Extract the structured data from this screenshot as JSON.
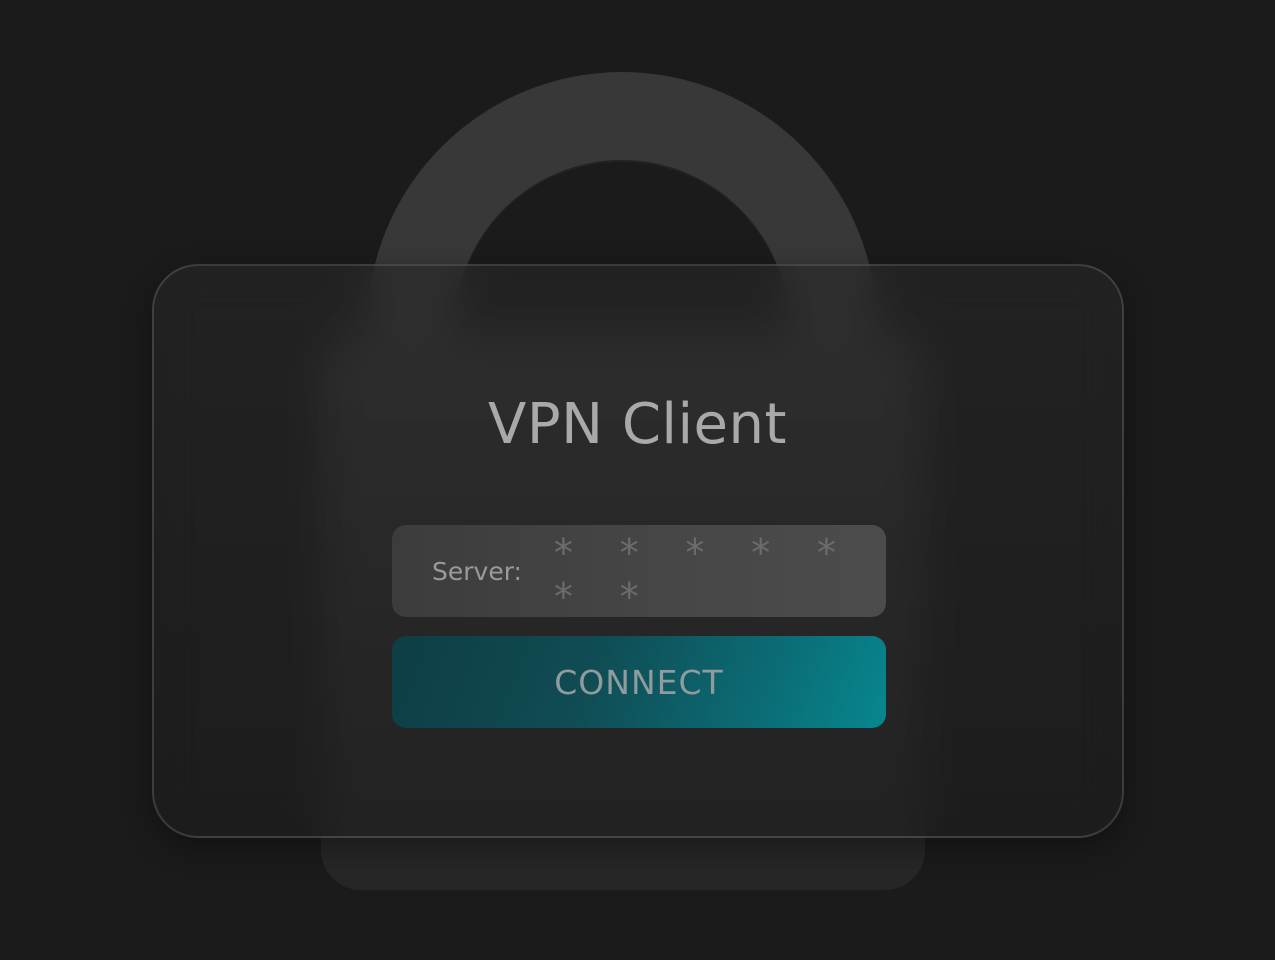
{
  "app": {
    "title": "VPN Client"
  },
  "server": {
    "label": "Server:",
    "value": "* * * * * * *"
  },
  "connect": {
    "label": "CONNECT"
  },
  "colors": {
    "background": "#1b1b1b",
    "lock": "#383838",
    "accent": "#07878f",
    "accent_dark": "#0e3d45"
  },
  "icons": {
    "lock": "padlock-icon"
  }
}
